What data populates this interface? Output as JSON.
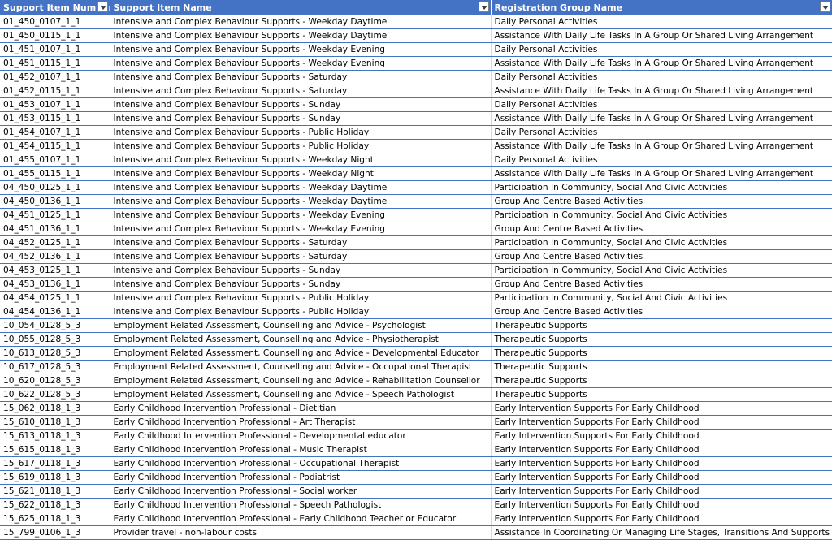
{
  "header": {
    "col1": "Support Item Number",
    "col2": "Support Item Name",
    "col3": "Registration Group Name"
  },
  "colors": {
    "header_bg": "#4472c4",
    "header_text": "#ffffff",
    "row_border": "#4472c4"
  },
  "rows": [
    [
      "01_450_0107_1_1",
      "Intensive and Complex Behaviour Supports - Weekday Daytime",
      "Daily Personal Activities"
    ],
    [
      "01_450_0115_1_1",
      "Intensive and Complex Behaviour Supports - Weekday Daytime",
      "Assistance With Daily Life Tasks In A Group Or Shared Living Arrangement"
    ],
    [
      "01_451_0107_1_1",
      "Intensive and Complex Behaviour Supports - Weekday Evening",
      "Daily Personal Activities"
    ],
    [
      "01_451_0115_1_1",
      "Intensive and Complex Behaviour Supports - Weekday Evening",
      "Assistance With Daily Life Tasks In A Group Or Shared Living Arrangement"
    ],
    [
      "01_452_0107_1_1",
      "Intensive and Complex Behaviour Supports - Saturday",
      "Daily Personal Activities"
    ],
    [
      "01_452_0115_1_1",
      "Intensive and Complex Behaviour Supports - Saturday",
      "Assistance With Daily Life Tasks In A Group Or Shared Living Arrangement"
    ],
    [
      "01_453_0107_1_1",
      "Intensive and Complex Behaviour Supports - Sunday",
      "Daily Personal Activities"
    ],
    [
      "01_453_0115_1_1",
      "Intensive and Complex Behaviour Supports - Sunday",
      "Assistance With Daily Life Tasks In A Group Or Shared Living Arrangement"
    ],
    [
      "01_454_0107_1_1",
      "Intensive and Complex Behaviour Supports - Public Holiday",
      "Daily Personal Activities"
    ],
    [
      "01_454_0115_1_1",
      "Intensive and Complex Behaviour Supports - Public Holiday",
      "Assistance With Daily Life Tasks In A Group Or Shared Living Arrangement"
    ],
    [
      "01_455_0107_1_1",
      "Intensive and Complex Behaviour Supports - Weekday Night",
      "Daily Personal Activities"
    ],
    [
      "01_455_0115_1_1",
      "Intensive and Complex Behaviour Supports - Weekday Night",
      "Assistance With Daily Life Tasks In A Group Or Shared Living Arrangement"
    ],
    [
      "04_450_0125_1_1",
      "Intensive and Complex Behaviour Supports - Weekday Daytime",
      "Participation In Community, Social And Civic Activities"
    ],
    [
      "04_450_0136_1_1",
      "Intensive and Complex Behaviour Supports - Weekday Daytime",
      "Group And Centre Based Activities"
    ],
    [
      "04_451_0125_1_1",
      "Intensive and Complex Behaviour Supports - Weekday Evening",
      "Participation In Community, Social And Civic Activities"
    ],
    [
      "04_451_0136_1_1",
      "Intensive and Complex Behaviour Supports - Weekday Evening",
      "Group And Centre Based Activities"
    ],
    [
      "04_452_0125_1_1",
      "Intensive and Complex Behaviour Supports - Saturday",
      "Participation In Community, Social And Civic Activities"
    ],
    [
      "04_452_0136_1_1",
      "Intensive and Complex Behaviour Supports - Saturday",
      "Group And Centre Based Activities"
    ],
    [
      "04_453_0125_1_1",
      "Intensive and Complex Behaviour Supports - Sunday",
      "Participation In Community, Social And Civic Activities"
    ],
    [
      "04_453_0136_1_1",
      "Intensive and Complex Behaviour Supports - Sunday",
      "Group And Centre Based Activities"
    ],
    [
      "04_454_0125_1_1",
      "Intensive and Complex Behaviour Supports - Public Holiday",
      "Participation In Community, Social And Civic Activities"
    ],
    [
      "04_454_0136_1_1",
      "Intensive and Complex Behaviour Supports - Public Holiday",
      "Group And Centre Based Activities"
    ],
    [
      "10_054_0128_5_3",
      "Employment Related  Assessment, Counselling and Advice - Psychologist",
      "Therapeutic Supports"
    ],
    [
      "10_055_0128_5_3",
      "Employment Related  Assessment, Counselling and Advice - Physiotherapist",
      "Therapeutic Supports"
    ],
    [
      "10_613_0128_5_3",
      "Employment Related  Assessment, Counselling and Advice - Developmental Educator",
      "Therapeutic Supports"
    ],
    [
      "10_617_0128_5_3",
      "Employment Related  Assessment, Counselling and Advice - Occupational Therapist",
      "Therapeutic Supports"
    ],
    [
      "10_620_0128_5_3",
      "Employment Related  Assessment, Counselling and Advice - Rehabilitation Counsellor",
      "Therapeutic Supports"
    ],
    [
      "10_622_0128_5_3",
      "Employment Related  Assessment, Counselling and Advice - Speech Pathologist",
      "Therapeutic Supports"
    ],
    [
      "15_062_0118_1_3",
      "Early Childhood Intervention Professional - Dietitian",
      "Early Intervention Supports For Early Childhood"
    ],
    [
      "15_610_0118_1_3",
      "Early Childhood Intervention Professional - Art Therapist",
      "Early Intervention Supports For Early Childhood"
    ],
    [
      "15_613_0118_1_3",
      "Early Childhood Intervention Professional - Developmental educator",
      "Early Intervention Supports For Early Childhood"
    ],
    [
      "15_615_0118_1_3",
      "Early Childhood Intervention Professional - Music Therapist",
      "Early Intervention Supports For Early Childhood"
    ],
    [
      "15_617_0118_1_3",
      "Early Childhood Intervention Professional - Occupational Therapist",
      "Early Intervention Supports For Early Childhood"
    ],
    [
      "15_619_0118_1_3",
      "Early Childhood Intervention Professional - Podiatrist",
      "Early Intervention Supports For Early Childhood"
    ],
    [
      "15_621_0118_1_3",
      "Early Childhood Intervention Professional - Social worker",
      "Early Intervention Supports For Early Childhood"
    ],
    [
      "15_622_0118_1_3",
      "Early Childhood Intervention Professional - Speech Pathologist",
      "Early Intervention Supports For Early Childhood"
    ],
    [
      "15_625_0118_1_3",
      "Early Childhood Intervention Professional - Early Childhood Teacher or Educator",
      "Early Intervention Supports For Early Childhood"
    ],
    [
      "15_799_0106_1_3",
      "Provider travel - non-labour costs",
      "Assistance In Coordinating Or Managing Life Stages, Transitions And Supports"
    ]
  ]
}
